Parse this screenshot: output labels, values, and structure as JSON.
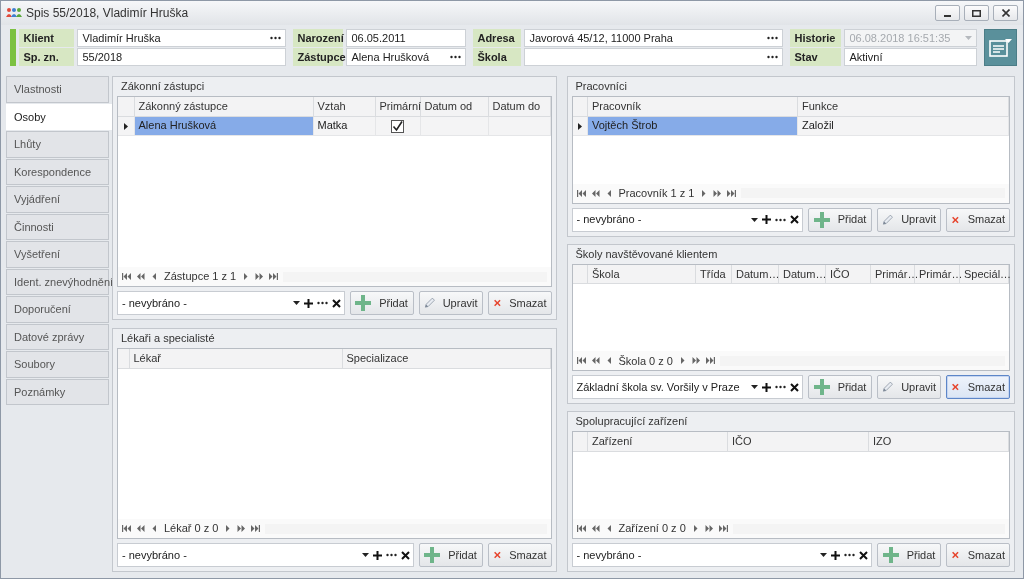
{
  "window": {
    "title": "Spis 55/2018, Vladimír Hruška"
  },
  "header": {
    "groups": [
      [
        {
          "label": "Klient",
          "value": "Vladimír Hruška",
          "kind": "lookup",
          "disabled": false
        },
        {
          "label": "Sp. zn.",
          "value": "55/2018",
          "kind": "text",
          "disabled": false
        }
      ],
      [
        {
          "label": "Narození",
          "value": "06.05.2011",
          "kind": "text",
          "disabled": false
        },
        {
          "label": "Zástupce",
          "value": "Alena Hrušková",
          "kind": "lookup",
          "disabled": false
        }
      ],
      [
        {
          "label": "Adresa",
          "value": "Javorová 45/12, 11000 Praha",
          "kind": "lookup",
          "disabled": false
        },
        {
          "label": "Škola",
          "kind": "lookup",
          "disabled": false
        }
      ],
      [
        {
          "label": "Historie",
          "value": "06.08.2018 16:51:35",
          "kind": "dropdown",
          "disabled": true
        },
        {
          "label": "Stav",
          "value": "Aktivní",
          "kind": "text",
          "disabled": false
        }
      ]
    ]
  },
  "sidebar": {
    "tabs": [
      {
        "label": "Vlastnosti",
        "selected": false
      },
      {
        "label": "Osoby",
        "selected": true
      },
      {
        "label": "Lhůty",
        "selected": false
      },
      {
        "label": "Korespondence",
        "selected": false
      },
      {
        "label": "Vyjádření",
        "selected": false
      },
      {
        "label": "Činnosti",
        "selected": false
      },
      {
        "label": "Vyšetření",
        "selected": false
      },
      {
        "label": "Ident. znevýhodnění",
        "selected": false
      },
      {
        "label": "Doporučení",
        "selected": false
      },
      {
        "label": "Datové zprávy",
        "selected": false
      },
      {
        "label": "Soubory",
        "selected": false
      },
      {
        "label": "Poznámky",
        "selected": false
      }
    ]
  },
  "left_panels": [
    {
      "title": "Zákonní zástupci",
      "columns": [
        "Zákonný zástupce",
        "Vztah",
        "Primární",
        "Datum od",
        "Datum do"
      ],
      "rows": [
        {
          "selected": true,
          "cells": [
            {
              "kind": "text",
              "text": "Alena Hrušková"
            },
            {
              "kind": "text",
              "text": "Matka"
            },
            {
              "kind": "check",
              "checked": true
            }
          ]
        }
      ],
      "pager": "Zástupce 1 z 1",
      "combo": "- nevybráno -",
      "buttons": [
        {
          "kind": "add",
          "label": "Přidat",
          "focused": false
        },
        {
          "kind": "edit",
          "label": "Upravit",
          "focused": false
        },
        {
          "kind": "delete",
          "label": "Smazat",
          "focused": false
        }
      ]
    },
    {
      "title": "Lékaři a specialisté",
      "columns": [
        "Lékař",
        "Specializace"
      ],
      "pager": "Lékař 0 z 0",
      "combo": "- nevybráno -",
      "buttons": [
        {
          "kind": "add",
          "label": "Přidat",
          "focused": false
        },
        {
          "kind": "delete",
          "label": "Smazat",
          "focused": false
        }
      ]
    }
  ],
  "right_panels": [
    {
      "title": "Pracovníci",
      "columns": [
        "Pracovník",
        "Funkce"
      ],
      "rows": [
        {
          "selected": true,
          "cells": [
            {
              "kind": "text",
              "text": "Vojtěch Štrob"
            },
            {
              "kind": "text",
              "text": "Založil"
            }
          ]
        }
      ],
      "pager": "Pracovník 1 z 1",
      "combo": "- nevybráno -",
      "buttons": [
        {
          "kind": "add",
          "label": "Přidat",
          "focused": false
        },
        {
          "kind": "edit",
          "label": "Upravit",
          "focused": false
        },
        {
          "kind": "delete",
          "label": "Smazat",
          "focused": false
        }
      ]
    },
    {
      "title": "Školy navštěvované klientem",
      "columns": [
        "Škola",
        "Třída",
        "Datum…",
        "Datum…",
        "IČO",
        "Primár…",
        "Primár…",
        "Speciál…"
      ],
      "pager": "Škola 0 z 0",
      "combo": "Základní škola sv. Voršily v Praze",
      "buttons": [
        {
          "kind": "add",
          "label": "Přidat",
          "focused": false
        },
        {
          "kind": "edit",
          "label": "Upravit",
          "focused": false
        },
        {
          "kind": "delete",
          "label": "Smazat",
          "focused": true
        }
      ]
    },
    {
      "title": "Spolupracující zařízení",
      "columns": [
        "Zařízení",
        "IČO",
        "IZO"
      ],
      "pager": "Zařízení 0 z 0",
      "combo": "- nevybráno -",
      "buttons": [
        {
          "kind": "add",
          "label": "Přidat",
          "focused": false
        },
        {
          "kind": "delete",
          "label": "Smazat",
          "focused": false
        }
      ]
    }
  ]
}
